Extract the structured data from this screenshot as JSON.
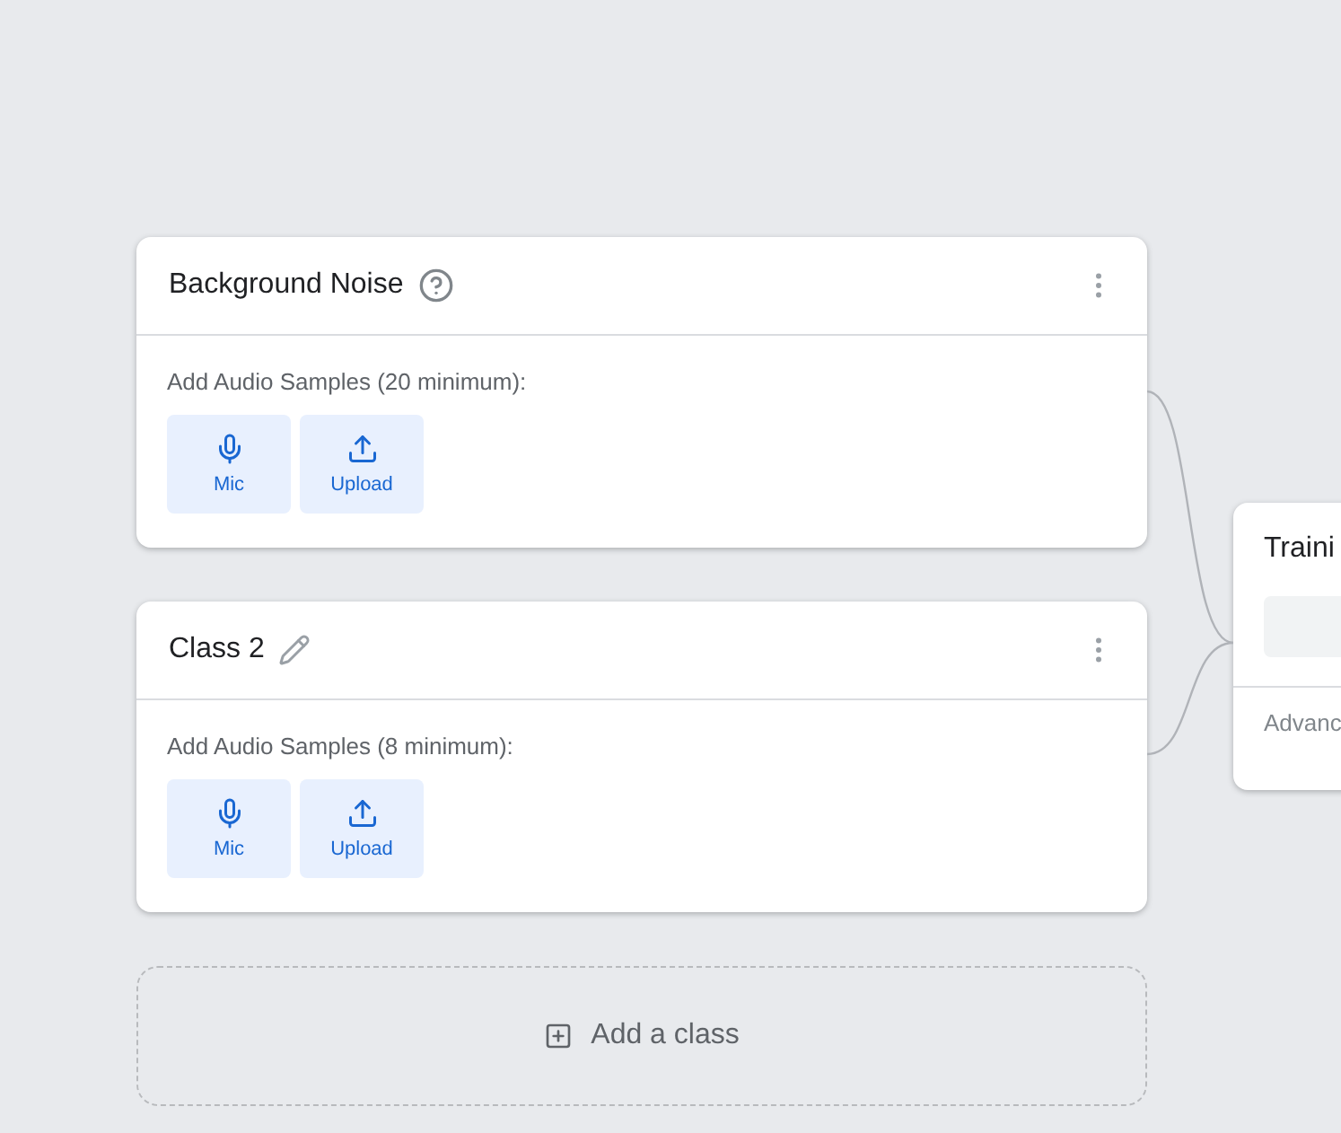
{
  "classes": [
    {
      "title": "Background Noise",
      "kind": "help",
      "samples_label": "Add Audio Samples (20 minimum):",
      "buttons": [
        {
          "kind": "mic",
          "label": "Mic"
        },
        {
          "kind": "upload",
          "label": "Upload"
        }
      ]
    },
    {
      "title": "Class 2",
      "kind": "edit",
      "samples_label": "Add Audio Samples (8 minimum):",
      "buttons": [
        {
          "kind": "mic",
          "label": "Mic"
        },
        {
          "kind": "upload",
          "label": "Upload"
        }
      ]
    }
  ],
  "add_class": {
    "label": "Add a class"
  },
  "training": {
    "title": "Traini",
    "footer": "Advanc"
  }
}
